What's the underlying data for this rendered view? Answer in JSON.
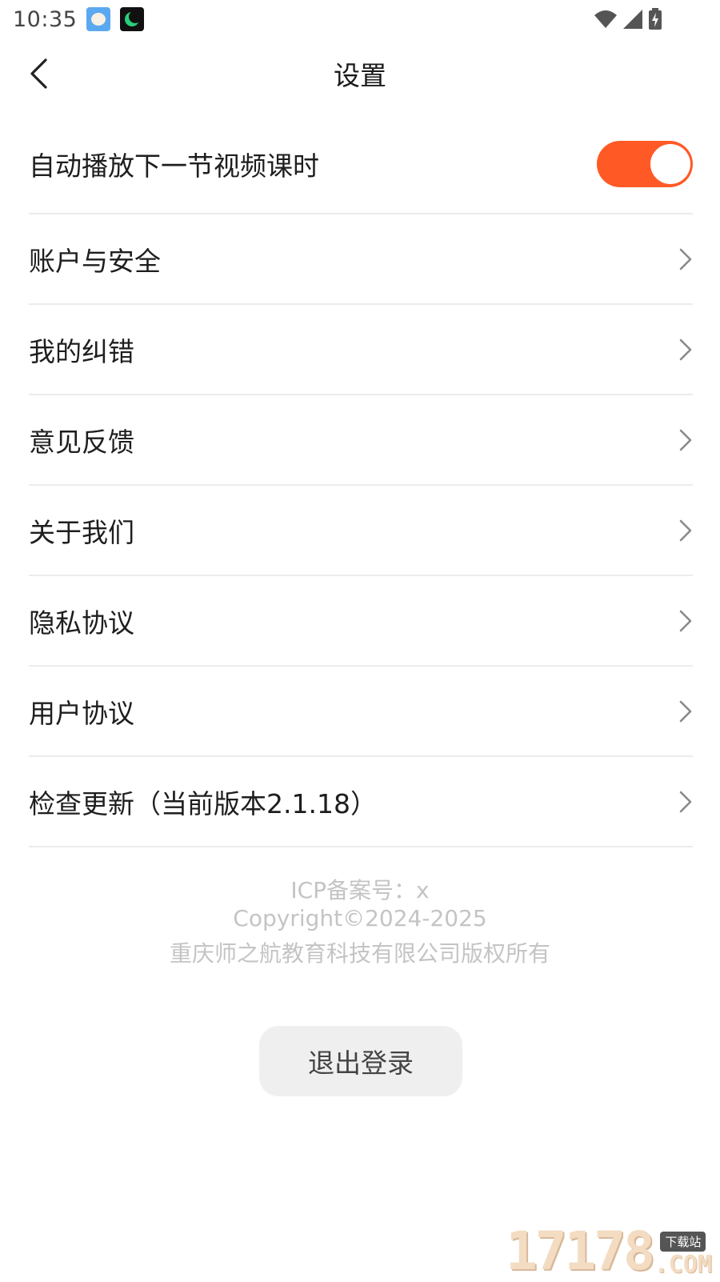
{
  "status_bar": {
    "time": "10:35",
    "apps": [
      "sheep-app-icon",
      "moon-app-icon"
    ],
    "icons": [
      "wifi-icon",
      "signal-icon",
      "battery-charging-icon"
    ]
  },
  "header": {
    "title": "设置",
    "back_icon": "chevron-left-icon"
  },
  "settings": {
    "autoplay": {
      "label": "自动播放下一节视频课时",
      "enabled": true,
      "toggle_color": "#FF5A26"
    },
    "items": [
      {
        "label": "账户与安全"
      },
      {
        "label": "我的纠错"
      },
      {
        "label": "意见反馈"
      },
      {
        "label": "关于我们"
      },
      {
        "label": "隐私协议"
      },
      {
        "label": "用户协议"
      },
      {
        "label": "检查更新（当前版本2.1.18）"
      }
    ],
    "chevron_icon": "chevron-right-icon"
  },
  "footer": {
    "icp": "ICP备案号：x",
    "copyright": "Copyright©2024-2025",
    "company": "重庆师之航教育科技有限公司版权所有"
  },
  "logout": {
    "label": "退出登录"
  },
  "watermark": {
    "digits": "17178",
    "tag": "下载站",
    "suffix": ".COM"
  }
}
